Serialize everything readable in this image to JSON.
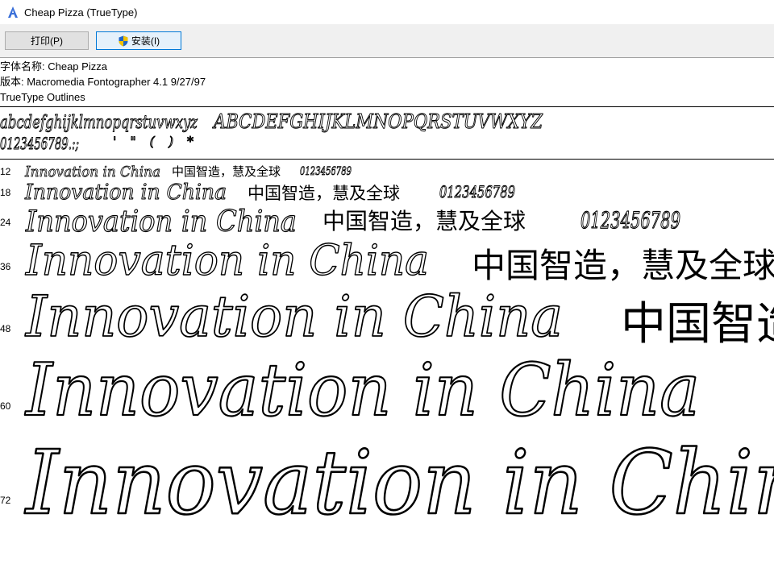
{
  "window": {
    "title": "Cheap Pizza (TrueType)"
  },
  "toolbar": {
    "print_label": "打印(P)",
    "install_label": "安装(I)"
  },
  "info": {
    "font_name": "字体名称: Cheap Pizza",
    "version": "版本: Macromedia Fontographer 4.1 9/27/97",
    "outline": "TrueType Outlines"
  },
  "charset": {
    "lowercase": "abcdefghijklmnopqrstuvwxyz",
    "uppercase": "ABCDEFGHIJKLMNOPQRSTUVWXYZ",
    "digits": "0123456789.:;",
    "symbols": "' \" ( ) *"
  },
  "samples": [
    {
      "size": "12",
      "latin": "Innovation in China",
      "cjk": "中国智造，慧及全球",
      "digits": "0123456789"
    },
    {
      "size": "18",
      "latin": "Innovation in China",
      "cjk": "中国智造，慧及全球",
      "digits": "0123456789"
    },
    {
      "size": "24",
      "latin": "Innovation in China",
      "cjk": "中国智造，慧及全球",
      "digits": "0123456789"
    },
    {
      "size": "36",
      "latin": "Innovation in China",
      "cjk": "中国智造，慧及全球",
      "digits": ""
    },
    {
      "size": "48",
      "latin": "Innovation in China",
      "cjk": "中国智造",
      "digits": ""
    },
    {
      "size": "60",
      "latin": "Innovation in China",
      "cjk": "",
      "digits": ""
    },
    {
      "size": "72",
      "latin": "Innovation in China",
      "cjk": "",
      "digits": ""
    }
  ]
}
